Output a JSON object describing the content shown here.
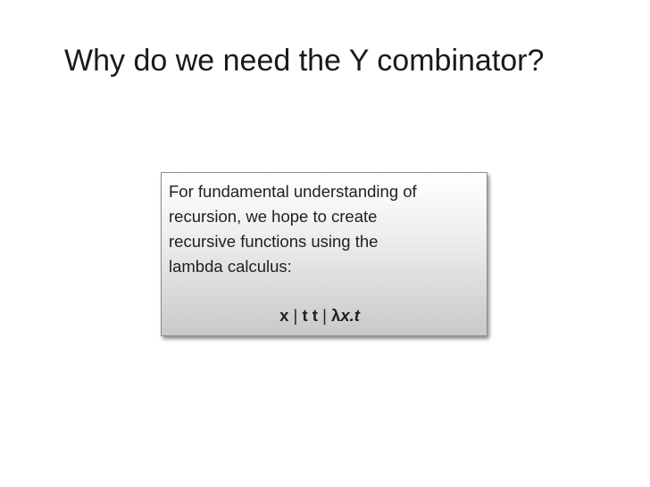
{
  "slide": {
    "title": "Why do we need the Y combinator?",
    "callout": {
      "lines": [
        "For fundamental understanding of",
        "recursion, we hope to create",
        "recursive functions using the",
        "lambda calculus:"
      ],
      "grammar": {
        "term_var": "x",
        "sep1": " | ",
        "term_app": "t t",
        "sep2": " | ",
        "lambda": "λ",
        "abs_body": "x.t"
      }
    }
  }
}
